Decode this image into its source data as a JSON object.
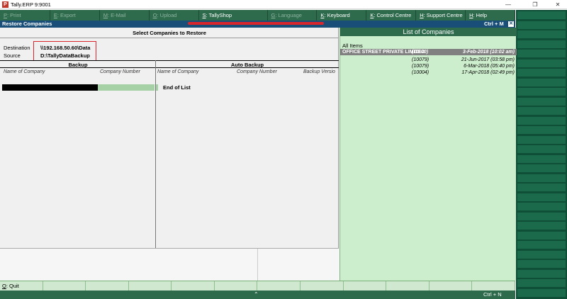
{
  "window": {
    "title": "Tally.ERP 9:9001",
    "icon_letter": "P",
    "minimize": "—",
    "restore": "❐",
    "close": "✕"
  },
  "top_menu": [
    {
      "key": "P",
      "label": ": Print",
      "enabled": false
    },
    {
      "key": "E",
      "label": ": Export",
      "enabled": false
    },
    {
      "key": "M",
      "label": ": E-Mail",
      "enabled": false
    },
    {
      "key": "O",
      "label": ": Upload",
      "enabled": false
    },
    {
      "key": "S",
      "label": ": TallyShop",
      "enabled": true
    },
    {
      "key": "G",
      "label": ": Language",
      "enabled": false
    },
    {
      "key": "K",
      "label": ": Keyboard",
      "enabled": true
    },
    {
      "key": "K",
      "label": ": Control Centre",
      "enabled": true
    },
    {
      "key": "H",
      "label": ": Support Centre",
      "enabled": true
    },
    {
      "key": "H",
      "label": ": Help",
      "enabled": true
    }
  ],
  "header": {
    "title": "Restore Companies",
    "shortcut": "Ctrl + M",
    "close_glyph": "✕"
  },
  "main": {
    "heading": "Select Companies to Restore",
    "destination_label": "Destination",
    "destination_value": "\\\\192.168.50.60\\Data",
    "source_label": "Source",
    "source_value": "D:\\TallyDataBackup",
    "backup_heading": "Backup",
    "auto_backup_heading": "Auto Backup",
    "backup_columns": [
      "Name of Company",
      "Company Number"
    ],
    "auto_columns": [
      "Name of Company",
      "Company Number",
      "Backup Versio"
    ],
    "end_of_list": "End of List"
  },
  "list_panel": {
    "title": "List of Companies",
    "all_items": "All Items",
    "rows": [
      {
        "name": "OFFICE STREET PRIVATE LIMITED",
        "number": "(11100)",
        "date": "3-Feb-2018 (10:02 am)",
        "selected": true
      },
      {
        "name": "",
        "number": "(10079)",
        "date": "21-Jun-2017 (03:58 pm)",
        "selected": false
      },
      {
        "name": "",
        "number": "(10079)",
        "date": "6-Mar-2018 (05:40 pm)",
        "selected": false
      },
      {
        "name": "",
        "number": "(10004)",
        "date": "17-Apr-2018 (02:49 pm)",
        "selected": false
      }
    ]
  },
  "bottom_bar": {
    "quit_key": "Q",
    "quit_label": ": Quit"
  },
  "footer": {
    "arrow": "⌃",
    "shortcut": "Ctrl + N"
  }
}
